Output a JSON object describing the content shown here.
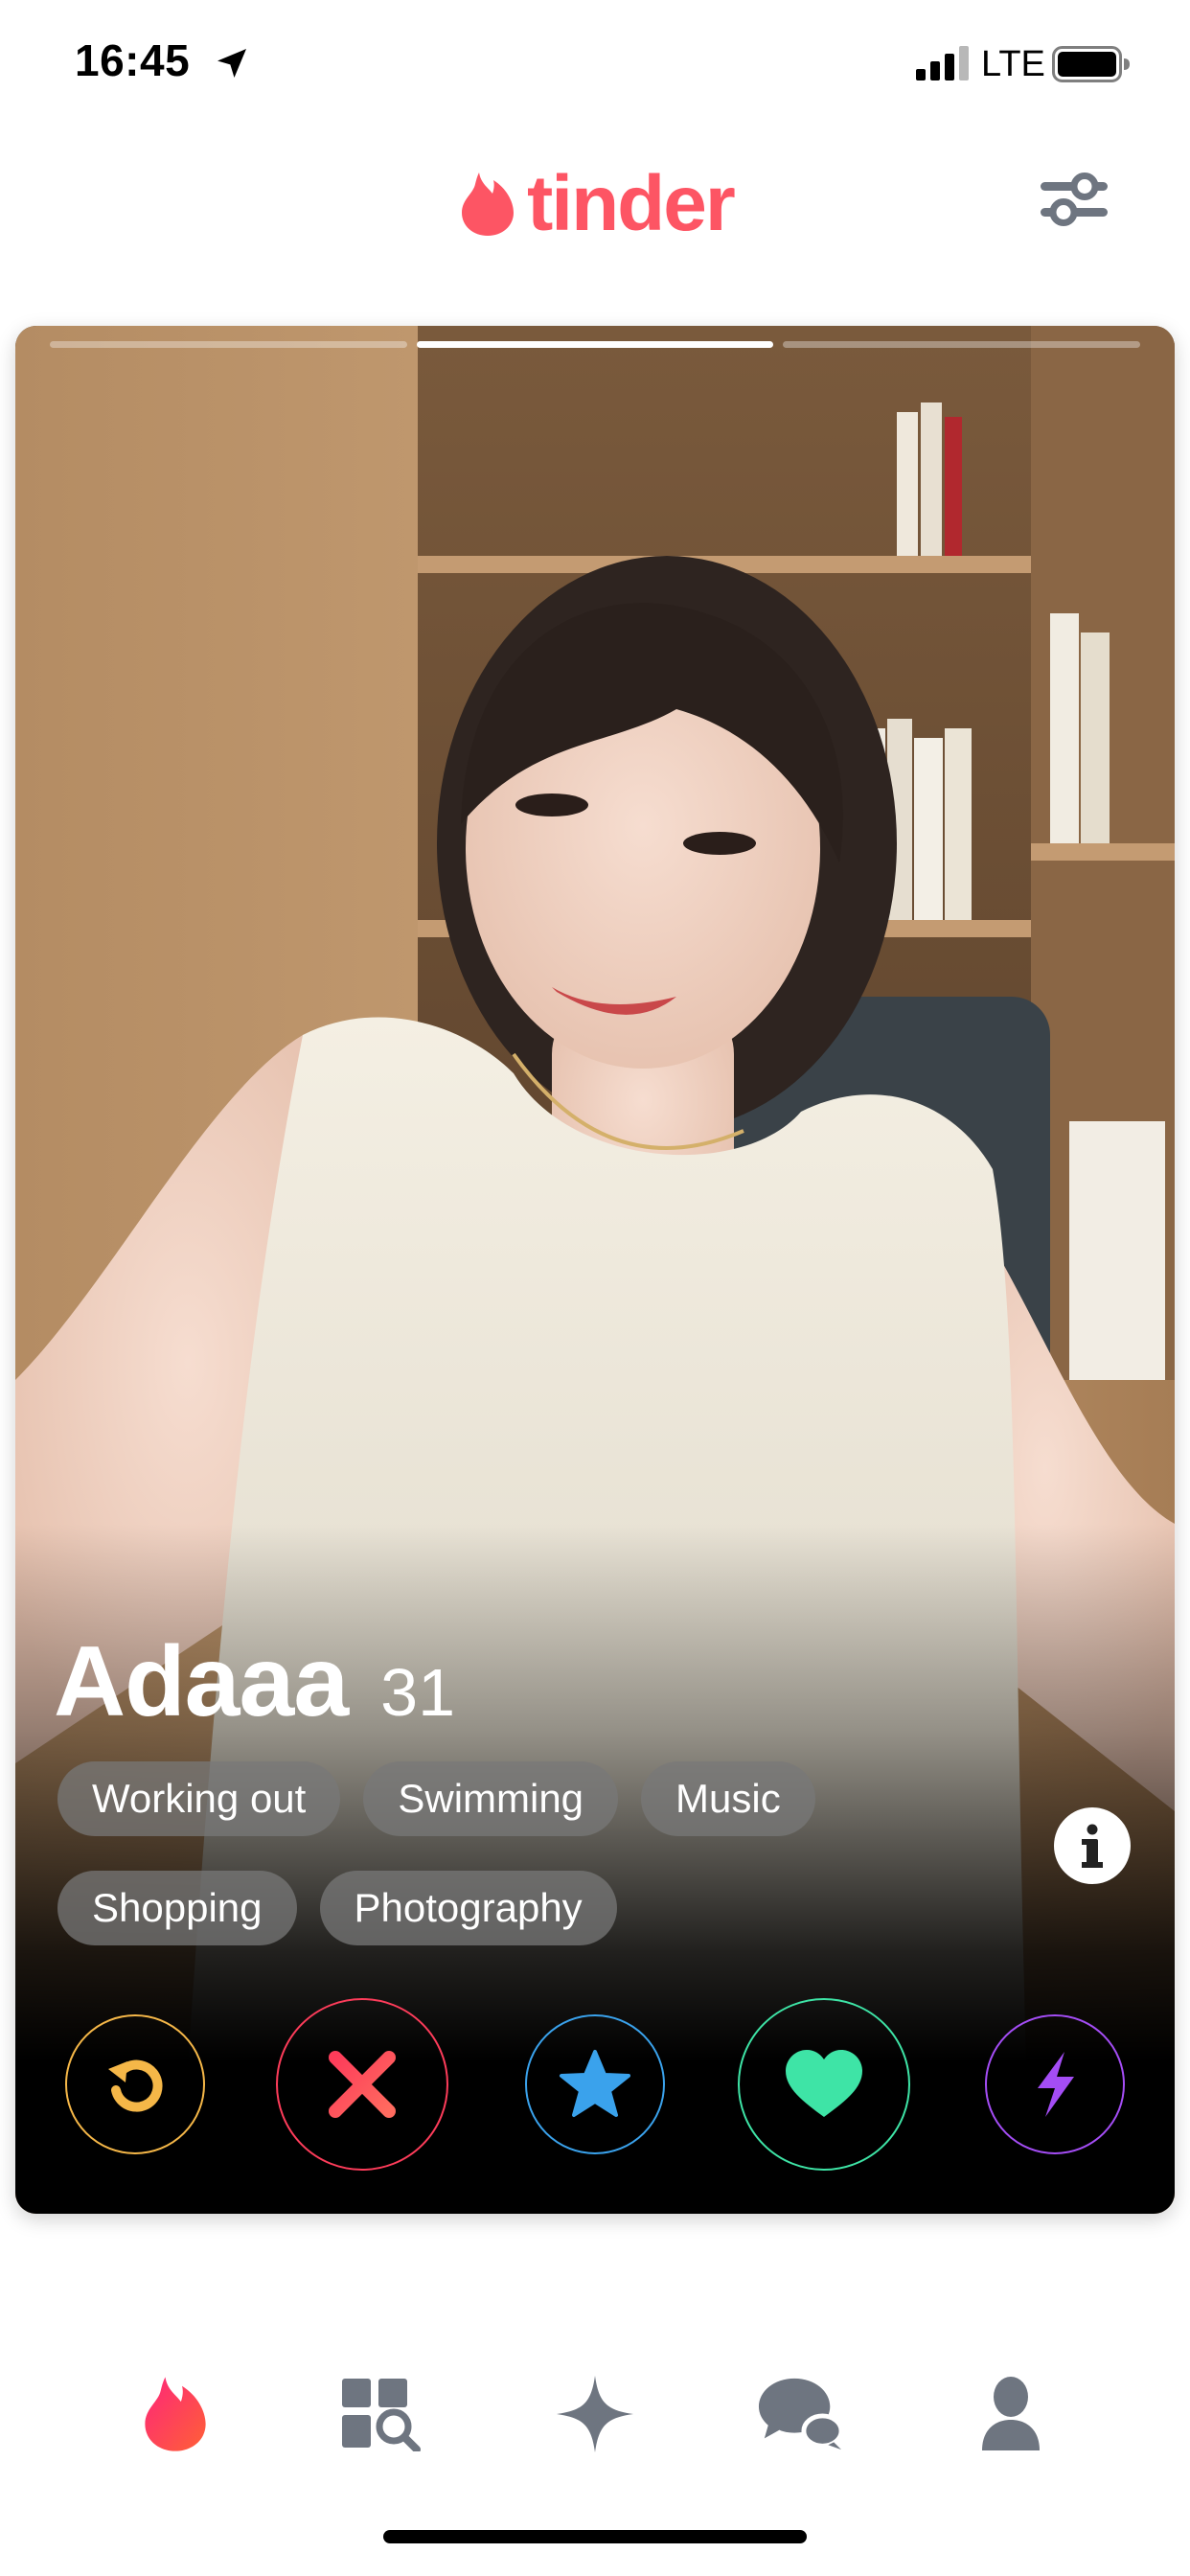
{
  "status_bar": {
    "time": "16:45",
    "network": "LTE",
    "icons": [
      "location-arrow-icon",
      "signal-icon",
      "battery-icon"
    ]
  },
  "header": {
    "logo_text": "tinder",
    "icons": [
      "tinder-flame-icon",
      "filter-sliders-icon"
    ],
    "brand_color": "#fd5564"
  },
  "card": {
    "photo_count": 3,
    "active_photo": 2,
    "name": "Adaaa",
    "age": "31",
    "tags": [
      "Working out",
      "Swimming",
      "Music",
      "Shopping",
      "Photography"
    ],
    "icons": [
      "info-icon"
    ]
  },
  "actions": [
    {
      "name": "rewind",
      "icon": "rewind-icon",
      "color": "#f5b748"
    },
    {
      "name": "nope",
      "icon": "x-icon",
      "color": "#fd3c5a"
    },
    {
      "name": "super-like",
      "icon": "star-icon",
      "color": "#3aa2ec"
    },
    {
      "name": "like",
      "icon": "heart-icon",
      "color": "#3ee4a6"
    },
    {
      "name": "boost",
      "icon": "lightning-icon",
      "color": "#a44df5"
    }
  ],
  "bottom_nav": [
    {
      "name": "home",
      "icon": "flame-icon",
      "active": true
    },
    {
      "name": "explore",
      "icon": "explore-icon",
      "active": false
    },
    {
      "name": "gold",
      "icon": "sparkle-icon",
      "active": false
    },
    {
      "name": "messages",
      "icon": "chat-icon",
      "active": false
    },
    {
      "name": "profile",
      "icon": "person-icon",
      "active": false
    }
  ]
}
